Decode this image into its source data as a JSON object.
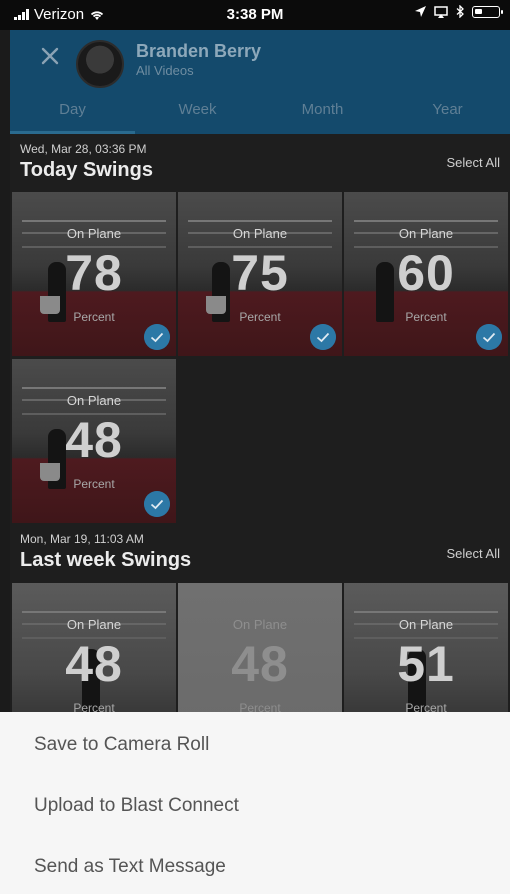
{
  "status_bar": {
    "carrier": "Verizon",
    "time": "3:38 PM"
  },
  "header": {
    "name": "Branden Berry",
    "subtitle": "All Videos",
    "tabs": [
      {
        "label": "Day",
        "active": true
      },
      {
        "label": "Week",
        "active": false
      },
      {
        "label": "Month",
        "active": false
      },
      {
        "label": "Year",
        "active": false
      }
    ]
  },
  "sections": [
    {
      "date": "Wed, Mar 28, 03:36 PM",
      "title": "Today Swings",
      "select_all": "Select All",
      "videos": [
        {
          "label": "On Plane",
          "value": "78",
          "unit": "Percent",
          "selected": true
        },
        {
          "label": "On Plane",
          "value": "75",
          "unit": "Percent",
          "selected": true
        },
        {
          "label": "On Plane",
          "value": "60",
          "unit": "Percent",
          "selected": true
        },
        {
          "label": "On Plane",
          "value": "48",
          "unit": "Percent",
          "selected": true
        }
      ]
    },
    {
      "date": "Mon, Mar 19, 11:03 AM",
      "title": "Last week Swings",
      "select_all": "Select All",
      "videos": [
        {
          "label": "On Plane",
          "value": "48",
          "unit": "Percent",
          "selected": false
        },
        {
          "label": "On Plane",
          "value": "48",
          "unit": "Percent",
          "selected": false
        },
        {
          "label": "On Plane",
          "value": "51",
          "unit": "Percent",
          "selected": false
        }
      ]
    }
  ],
  "action_sheet": {
    "items": [
      "Save to Camera Roll",
      "Upload to Blast Connect",
      "Send as Text Message"
    ]
  },
  "colors": {
    "header": "#144a6c",
    "accent": "#2c78a6",
    "sheet": "#f6f6f6"
  }
}
